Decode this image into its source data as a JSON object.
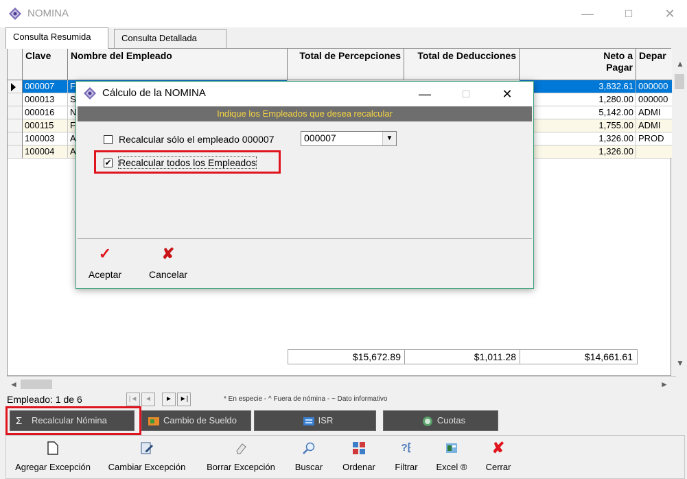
{
  "window": {
    "title": "NOMINA",
    "minimize": "—",
    "maximize": "☐",
    "close": "✕"
  },
  "tabs": [
    {
      "label": "Consulta Resumida"
    },
    {
      "label": "Consulta Detallada"
    }
  ],
  "grid": {
    "columns": {
      "clave": "Clave",
      "nombre": "Nombre del Empleado",
      "percepciones": "Total de Percepciones",
      "deducciones": "Total de Deducciones",
      "neto": "Neto a Pagar",
      "depto": "Depar"
    },
    "rows": [
      {
        "clave": "000007",
        "nombre": "F",
        "neto": "3,832.61",
        "depto": "000000"
      },
      {
        "clave": "000013",
        "nombre": "S",
        "neto": "1,280.00",
        "depto": "000000"
      },
      {
        "clave": "000016",
        "nombre": "N",
        "neto": "5,142.00",
        "depto": "ADMI"
      },
      {
        "clave": "000115",
        "nombre": "F",
        "neto": "1,755.00",
        "depto": "ADMI"
      },
      {
        "clave": "100003",
        "nombre": "A",
        "neto": "1,326.00",
        "depto": "PROD"
      },
      {
        "clave": "100004",
        "nombre": "A",
        "neto": "1,326.00",
        "depto": ""
      }
    ],
    "totals": {
      "percepciones": "$15,672.89",
      "deducciones": "$1,011.28",
      "neto": "$14,661.61"
    }
  },
  "status": {
    "text": "Empleado: 1 de 6",
    "nav": [
      "|◄",
      "◄",
      "►",
      "►|"
    ],
    "legend": "* En especie - ^ Fuera de nómina - ~ Dato informativo"
  },
  "tool_buttons": [
    {
      "label": "Recalcular Nómina"
    },
    {
      "label": "Cambio de Sueldo"
    },
    {
      "label": "ISR"
    },
    {
      "label": "Cuotas"
    }
  ],
  "bottom_toolbar": [
    {
      "label": "Agregar Excepción"
    },
    {
      "label": "Cambiar Excepción"
    },
    {
      "label": "Borrar Excepción"
    },
    {
      "label": "Buscar"
    },
    {
      "label": "Ordenar"
    },
    {
      "label": "Filtrar"
    },
    {
      "label": "Excel ®"
    },
    {
      "label": "Cerrar"
    }
  ],
  "dialog": {
    "title": "Cálculo de la NOMINA",
    "minimize": "—",
    "maximize": "☐",
    "close": "✕",
    "banner": "Indique los Empleados que desea recalcular",
    "option_single": "Recalcular sólo el empleado 000007",
    "option_single_checked": false,
    "combo_value": "000007",
    "option_all": "Recalcular todos los Empleados",
    "option_all_checked": true,
    "check_mark": "✔",
    "accept": "Aceptar",
    "cancel": "Cancelar"
  },
  "colors": {
    "selected_row": "#0078d7",
    "highlight": "#e0141e",
    "banner_text": "#f5d442",
    "accept_icon": "#e0141e"
  }
}
